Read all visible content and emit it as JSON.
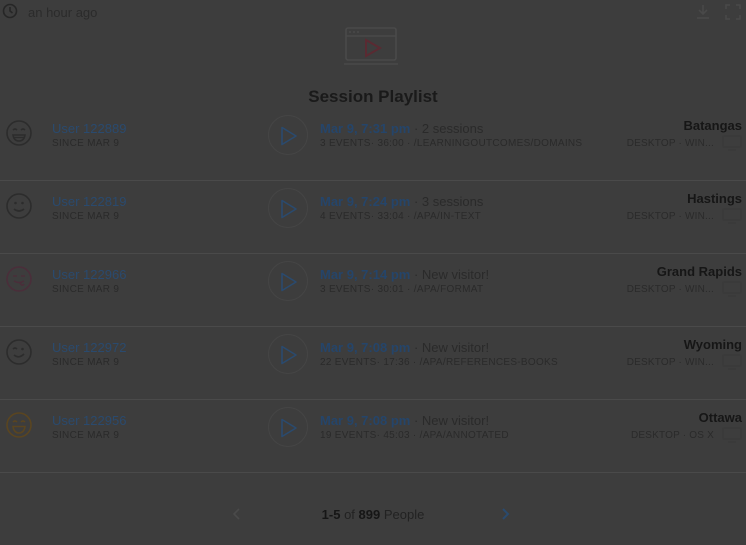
{
  "header": {
    "time_ago": "an hour ago",
    "icons": [
      "clock-icon",
      "download-icon",
      "fullscreen-icon"
    ]
  },
  "hero_icon": "video-playlist-icon",
  "title": "Session Playlist",
  "sessions": [
    {
      "user": "User 122889",
      "since": "SINCE MAR 9",
      "face": "grinning",
      "face_color": "#2c2c2c",
      "time": "Mar 9, 7:31 pm",
      "sessions_note": "· 2 sessions",
      "details": "3 EVENTS· 36:00 · /LEARNINGOUTCOMES/DOMAINS",
      "city": "Batangas",
      "device": "DESKTOP · WIN..."
    },
    {
      "user": "User 122819",
      "since": "SINCE MAR 9",
      "face": "smile",
      "face_color": "#2c2c2c",
      "time": "Mar 9, 7:24 pm",
      "sessions_note": "· 3 sessions",
      "details": "4 EVENTS· 33:04 · /APA/IN-TEXT",
      "city": "Hastings",
      "device": "DESKTOP · WIN..."
    },
    {
      "user": "User 122966",
      "since": "SINCE MAR 9",
      "face": "tongue",
      "face_color": "#4a2e3a",
      "time": "Mar 9, 7:14 pm",
      "sessions_note": "· New visitor!",
      "details": "3 EVENTS· 30:01 · /APA/FORMAT",
      "city": "Grand Rapids",
      "device": "DESKTOP · WIN..."
    },
    {
      "user": "User 122972",
      "since": "SINCE MAR 9",
      "face": "wink",
      "face_color": "#2c2c2c",
      "time": "Mar 9, 7:08 pm",
      "sessions_note": "· New visitor!",
      "details": "22 EVENTS· 17:36 · /APA/REFERENCES-BOOKS",
      "city": "Wyoming",
      "device": "DESKTOP · WIN..."
    },
    {
      "user": "User 122956",
      "since": "SINCE MAR 9",
      "face": "grin-yellow",
      "face_color": "#5a4520",
      "time": "Mar 9, 7:08 pm",
      "sessions_note": "· New visitor!",
      "details": "19 EVENTS· 45:03 · /APA/ANNOTATED",
      "city": "Ottawa",
      "device": "DESKTOP · OS X"
    }
  ],
  "pagination": {
    "range": "1-5",
    "of": "of",
    "total": "899",
    "unit": "People"
  }
}
